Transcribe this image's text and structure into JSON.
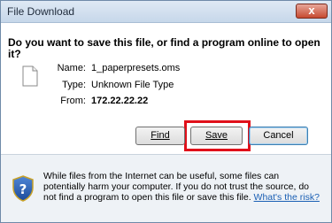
{
  "window": {
    "title": "File Download",
    "close_symbol": "x"
  },
  "dialog": {
    "question": "Do you want to save this file, or find a program online to open it?",
    "file": {
      "name_label": "Name:",
      "name_value": "1_paperpresets.oms",
      "type_label": "Type:",
      "type_value": "Unknown File Type",
      "from_label": "From:",
      "from_value": "172.22.22.22"
    },
    "buttons": {
      "find_label": "Find",
      "save_label": "Save",
      "cancel_label": "Cancel"
    }
  },
  "footer": {
    "warning_text": "While files from the Internet can be useful, some files can potentially harm your computer. If you do not trust the source, do not find a program to open this file or save this file.",
    "risk_link": "What's the risk?"
  },
  "icons": {
    "file": "file-icon",
    "shield": "shield-icon",
    "close": "close-icon"
  },
  "colors": {
    "highlight": "#e0101a",
    "link": "#1a5fb4"
  }
}
